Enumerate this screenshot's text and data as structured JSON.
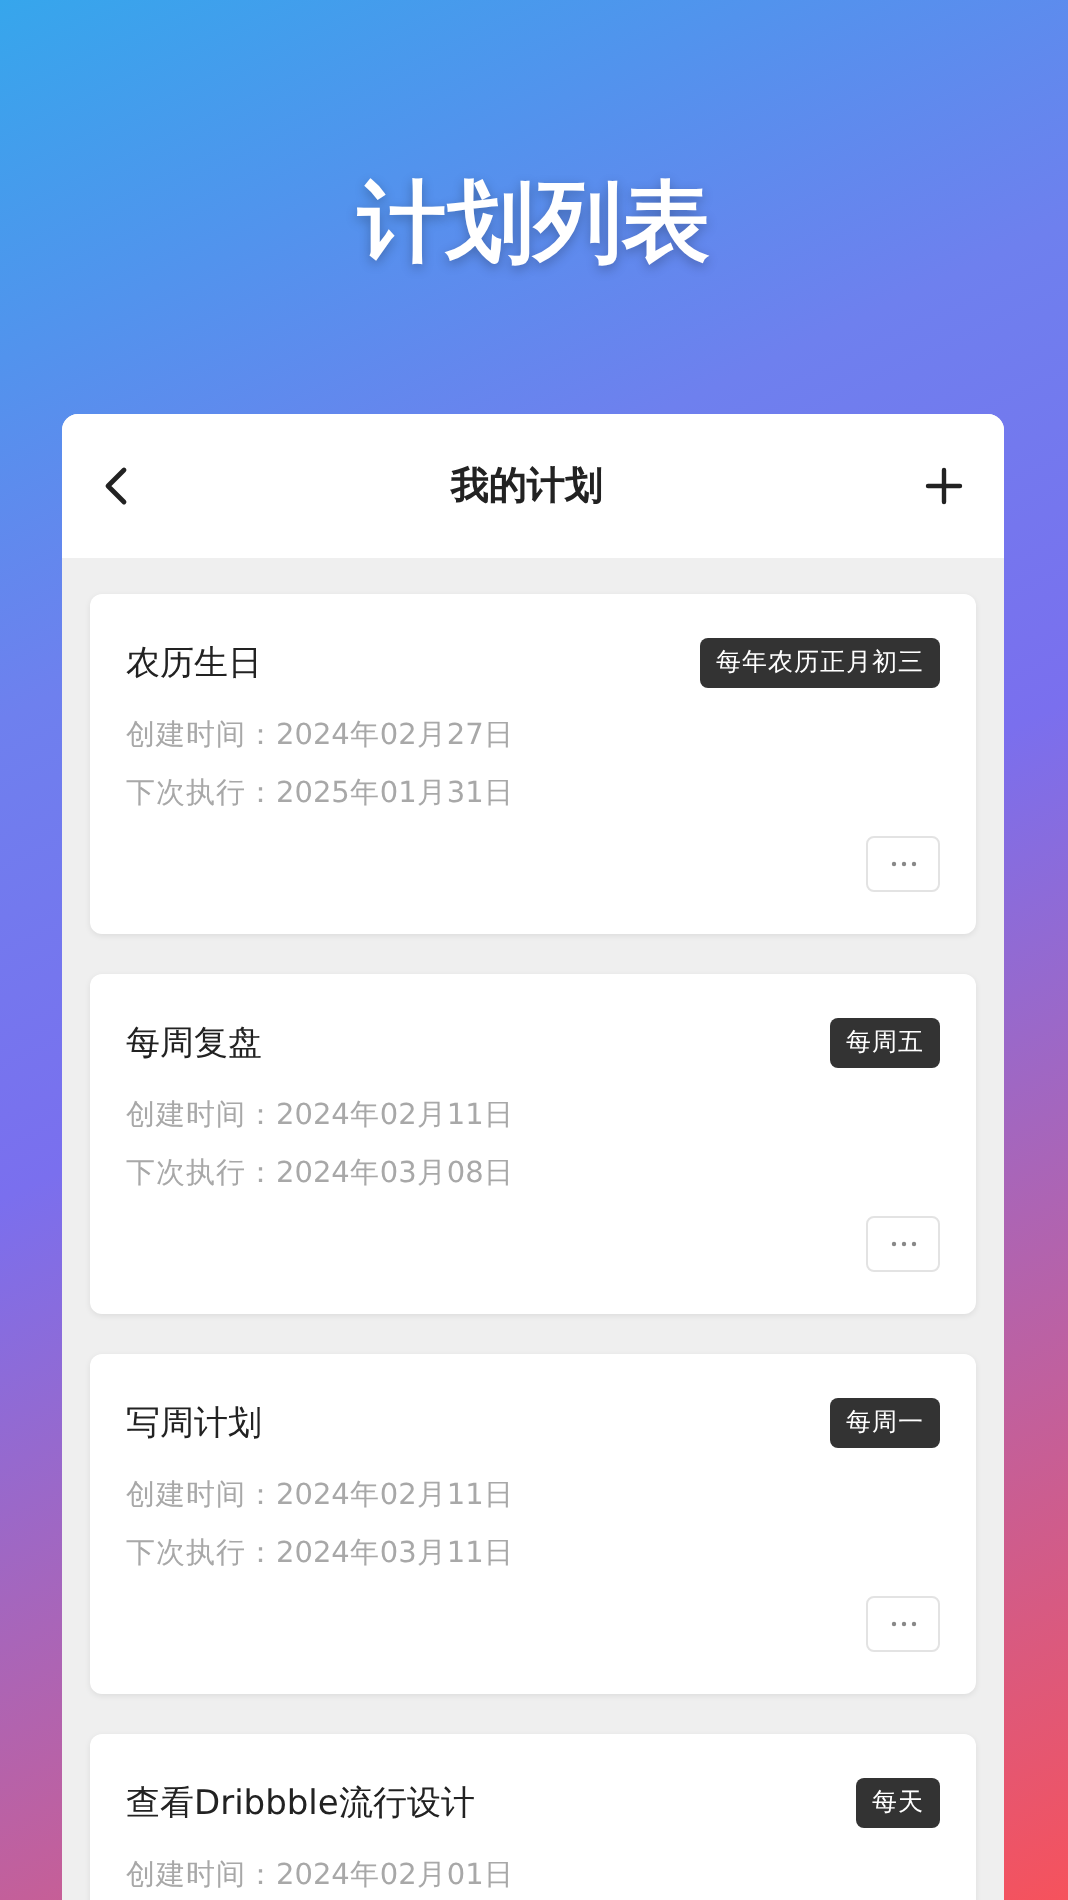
{
  "page_title": "计划列表",
  "header": {
    "title": "我的计划"
  },
  "plans": [
    {
      "title": "农历生日",
      "tag": "每年农历正月初三",
      "created": "创建时间：2024年02月27日",
      "next": "下次执行：2025年01月31日"
    },
    {
      "title": "每周复盘",
      "tag": "每周五",
      "created": "创建时间：2024年02月11日",
      "next": "下次执行：2024年03月08日"
    },
    {
      "title": "写周计划",
      "tag": "每周一",
      "created": "创建时间：2024年02月11日",
      "next": "下次执行：2024年03月11日"
    },
    {
      "title": "查看Dribbble流行设计",
      "tag": "每天",
      "created": "创建时间：2024年02月01日"
    }
  ]
}
